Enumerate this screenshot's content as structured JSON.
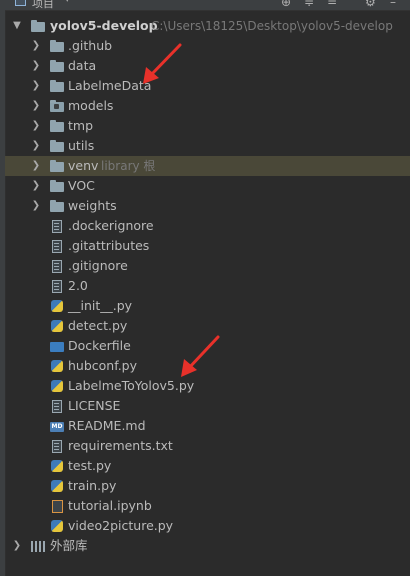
{
  "header": {
    "title": "项目",
    "toolbar_icons": [
      "target-icon",
      "collapse-icon",
      "expand-icon",
      "gear-icon",
      "minimize-icon"
    ]
  },
  "tree": {
    "root": {
      "label": "yolov5-develop",
      "path": "C:\\Users\\18125\\Desktop\\yolov5-develop"
    },
    "items": [
      {
        "label": ".github",
        "type": "folder"
      },
      {
        "label": "data",
        "type": "folder"
      },
      {
        "label": "LabelmeData",
        "type": "folder"
      },
      {
        "label": "models",
        "type": "module"
      },
      {
        "label": "tmp",
        "type": "folder"
      },
      {
        "label": "utils",
        "type": "folder"
      },
      {
        "label": "venv",
        "type": "folder",
        "hint": "library 根"
      },
      {
        "label": "VOC",
        "type": "folder"
      },
      {
        "label": "weights",
        "type": "folder"
      },
      {
        "label": ".dockerignore",
        "type": "file"
      },
      {
        "label": ".gitattributes",
        "type": "file"
      },
      {
        "label": ".gitignore",
        "type": "file"
      },
      {
        "label": "2.0",
        "type": "file"
      },
      {
        "label": "__init__.py",
        "type": "py"
      },
      {
        "label": "detect.py",
        "type": "py"
      },
      {
        "label": "Dockerfile",
        "type": "docker"
      },
      {
        "label": "hubconf.py",
        "type": "py"
      },
      {
        "label": "LabelmeToYolov5.py",
        "type": "py"
      },
      {
        "label": "LICENSE",
        "type": "file"
      },
      {
        "label": "README.md",
        "type": "md"
      },
      {
        "label": "requirements.txt",
        "type": "file"
      },
      {
        "label": "test.py",
        "type": "py"
      },
      {
        "label": "train.py",
        "type": "py"
      },
      {
        "label": "tutorial.ipynb",
        "type": "nb"
      },
      {
        "label": "video2picture.py",
        "type": "py"
      }
    ],
    "external": {
      "label": "外部库"
    }
  },
  "colors": {
    "background": "#2b2b2b",
    "highlight_row": "#4a4838",
    "annotation_arrow": "#e8312a"
  }
}
